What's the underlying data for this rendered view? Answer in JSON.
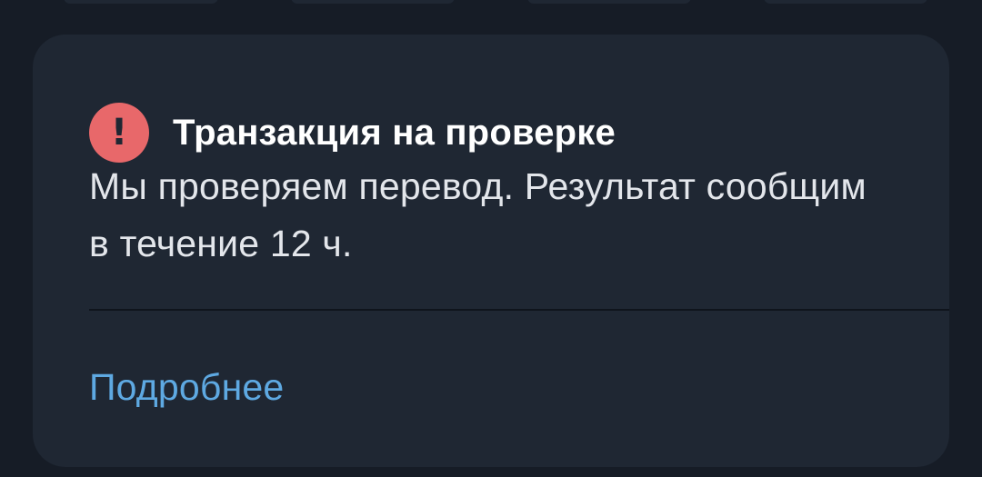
{
  "notification": {
    "title": "Транзакция на проверке",
    "message": "Мы проверяем перевод. Результат сообщим в течение 12 ч.",
    "link_label": "Подробнее",
    "icon": "exclamation-alert-icon",
    "icon_glyph": "!"
  },
  "colors": {
    "background": "#161c26",
    "card": "#1f2733",
    "alert": "#e8686a",
    "link": "#5ea9e2",
    "title": "#ffffff",
    "text": "#e3e6eb"
  }
}
